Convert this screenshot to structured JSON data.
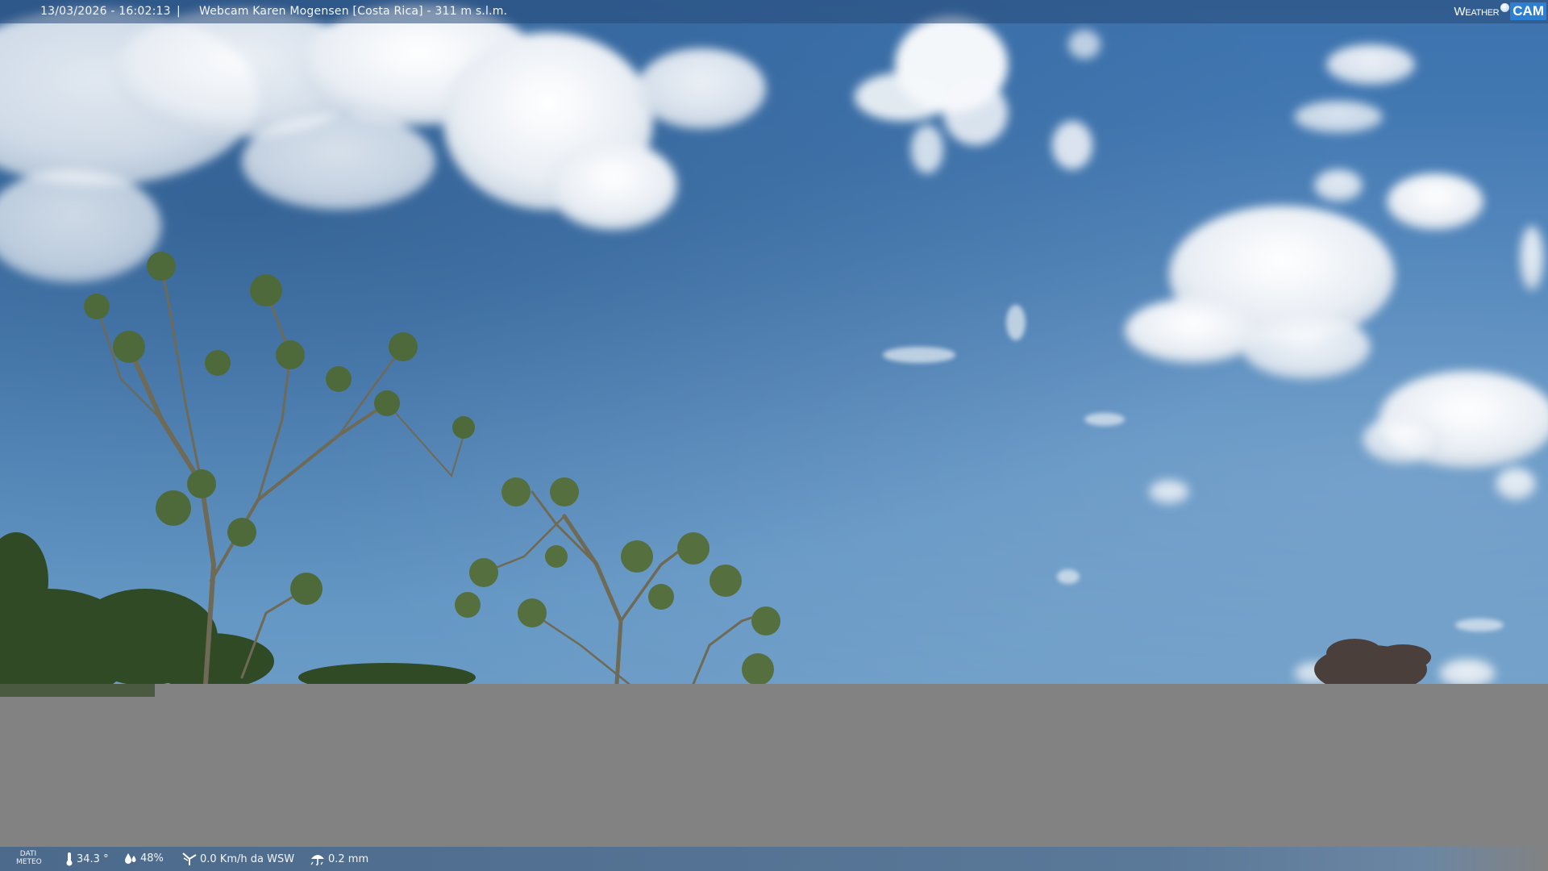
{
  "header": {
    "datetime": "13/03/2026 - 16:02:13",
    "separator": "|",
    "title": "Webcam Karen Mogensen [Costa Rica]  - 311 m s.l.m."
  },
  "brand": {
    "weather": "Weather",
    "cam": "CAM"
  },
  "footer": {
    "dati_line1": "DATI",
    "dati_line2": "METEO",
    "temperature": "34.3 °",
    "humidity": "48%",
    "wind": "0.0 Km/h da WSW",
    "rain": "0.2 mm"
  },
  "icons": [
    "thermometer-icon",
    "humidity-icon",
    "wind-icon",
    "rain-icon",
    "globe-icon"
  ],
  "colors": {
    "sky_top": "#3c72ad",
    "sky_bottom": "#6a9bc6",
    "bar": "#4b6a8c",
    "brand_cam": "#2f7fd0",
    "gray_fill": "#828282"
  }
}
